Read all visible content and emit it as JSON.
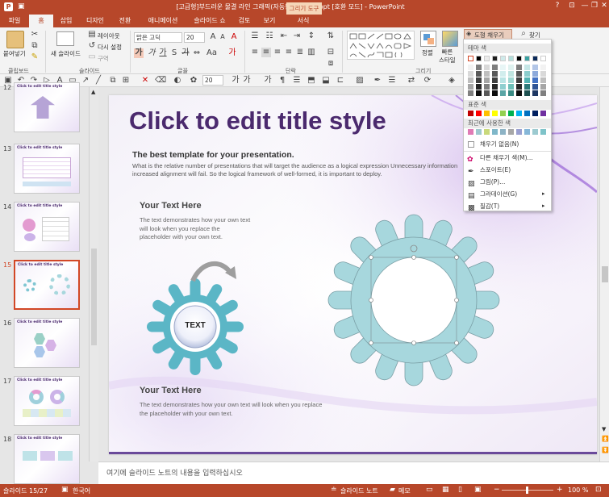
{
  "window": {
    "title": "[고급형]부드러운 물결 라인 그래픽(자동완성형포함).ppt [호환 모드] - PowerPoint",
    "context_tab_group": "그리기 도구",
    "controls": [
      "?",
      "⊡",
      "—",
      "❐",
      "✕"
    ]
  },
  "tabs": [
    "파일",
    "홈",
    "삽입",
    "디자인",
    "전환",
    "애니메이션",
    "슬라이드 쇼",
    "검토",
    "보기",
    "서식"
  ],
  "ribbon": {
    "paste_label": "붙여넣기",
    "new_slide_label": "새 슬라이드",
    "layout_label": "레이아웃",
    "reset_label": "다시 설정",
    "section_label": "구역",
    "font_name": "맑은 고딕",
    "font_size": "20",
    "arrange_label": "정렬",
    "quick_styles_label": "빠른\n스타일",
    "shape_fill_label": "도형 채우기",
    "find_label": "찾기",
    "groups": [
      "클립보드",
      "슬라이드",
      "글꼴",
      "단락",
      "그리기"
    ]
  },
  "qat": {
    "font_size": "20"
  },
  "thumbnails": [
    {
      "num": "12",
      "selected": false
    },
    {
      "num": "13",
      "selected": false
    },
    {
      "num": "14",
      "selected": false
    },
    {
      "num": "15",
      "selected": true
    },
    {
      "num": "16",
      "selected": false
    },
    {
      "num": "17",
      "selected": false
    },
    {
      "num": "18",
      "selected": false
    }
  ],
  "thumb_title": "Click to edit title style",
  "slide": {
    "title": "Click to edit title style",
    "subtitle": "The best template for your presentation.",
    "body": "What is the relative number of presentations that will target the audience as a logical expression Unnecessary information increased alignment will fail. So the logical framework of well-formed, it is important to deploy.",
    "block1_heading": "Your Text Here",
    "block1_text": "The text demonstrates how your own text will look when you replace the placeholder with your own text.",
    "gear_label": "TEXT",
    "block2_heading": "Your Text Here",
    "block2_text": "The text demonstrates how your own text will look when you replace the placeholder with your own text."
  },
  "notes_placeholder": "여기에 슬라이드 노트의 내용을 입력하십시오",
  "status": {
    "slide_counter": "슬라이드 15/27",
    "language": "한국어",
    "notes_label": "슬라이드 노트",
    "comments_label": "메모",
    "zoom": "100 %"
  },
  "fill_dropdown": {
    "theme_colors_label": "테마 색",
    "standard_colors_label": "표준 색",
    "recent_colors_label": "최근에 사용한 색",
    "no_fill": "채우기 없음(N)",
    "more_colors": "다른 채우기 색(M)...",
    "eyedropper": "스포이트(E)",
    "picture": "그림(P)...",
    "gradient": "그라데이션(G)",
    "texture": "질감(T)",
    "theme_row_top": [
      "#ffffff",
      "#000000",
      "#ebebeb",
      "#1f1f1f",
      "#cfeaea",
      "#b2dfdb",
      "#000000",
      "#3ca2a2",
      "#0b2a5a",
      "#ffffff"
    ],
    "standard_colors": [
      "#c00000",
      "#ff0000",
      "#ffc000",
      "#ffff00",
      "#92d050",
      "#00b050",
      "#00b0f0",
      "#0070c0",
      "#002060",
      "#7030a0"
    ],
    "recent_colors": [
      "#e07bb5",
      "#9ec8cf",
      "#c9d97b",
      "#7fb7c9",
      "#8db3c5",
      "#a7a7a7",
      "#9aa0d0",
      "#86b7d8",
      "#9ccad0",
      "#7ec3c9"
    ]
  },
  "colors": {
    "accent": "#b7472a",
    "title_purple": "#4b2a6e",
    "gear_teal": "#a7d7dd"
  }
}
